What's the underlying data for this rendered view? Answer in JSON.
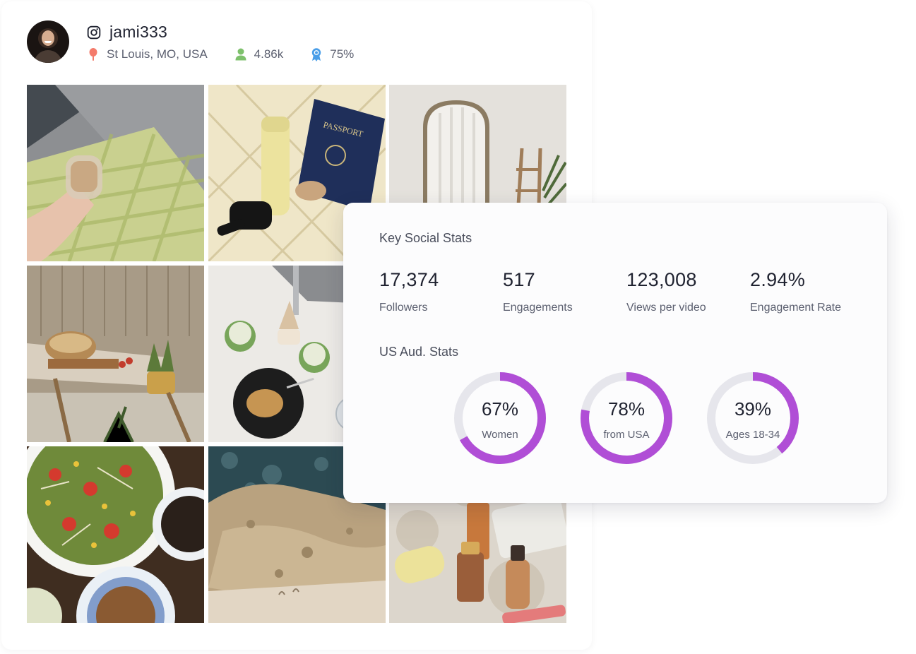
{
  "profile": {
    "platform_icon": "instagram-icon",
    "handle": "jami333",
    "location": "St Louis, MO, USA",
    "followers_short": "4.86k",
    "score": "75%"
  },
  "photos": [
    {
      "subject": "iced coffee on gingham"
    },
    {
      "subject": "passport and sunglasses"
    },
    {
      "subject": "arched mirror room"
    },
    {
      "subject": "bread on patio table"
    },
    {
      "subject": "matcha and cookie"
    },
    {
      "subject": "salad plates"
    },
    {
      "subject": "rocky coast from above"
    },
    {
      "subject": "beauty products"
    }
  ],
  "key_stats": {
    "title": "Key Social Stats",
    "items": [
      {
        "value": "17,374",
        "label": "Followers"
      },
      {
        "value": "517",
        "label": "Engagements"
      },
      {
        "value": "123,008",
        "label": "Views per video"
      },
      {
        "value": "2.94%",
        "label": "Engagement Rate"
      }
    ]
  },
  "audience": {
    "title": "US Aud. Stats",
    "donuts": [
      {
        "pct": "67%",
        "label": "Women",
        "fraction": 0.67
      },
      {
        "pct": "78%",
        "label": "from USA",
        "fraction": 0.78
      },
      {
        "pct": "39%",
        "label": "Ages 18-34",
        "fraction": 0.39
      }
    ]
  },
  "colors": {
    "accent": "#b04ed6",
    "track": "#e6e6ec",
    "location_pin": "#f47b6b",
    "followers_icon": "#7ec16c",
    "score_badge": "#4a9ee8"
  }
}
